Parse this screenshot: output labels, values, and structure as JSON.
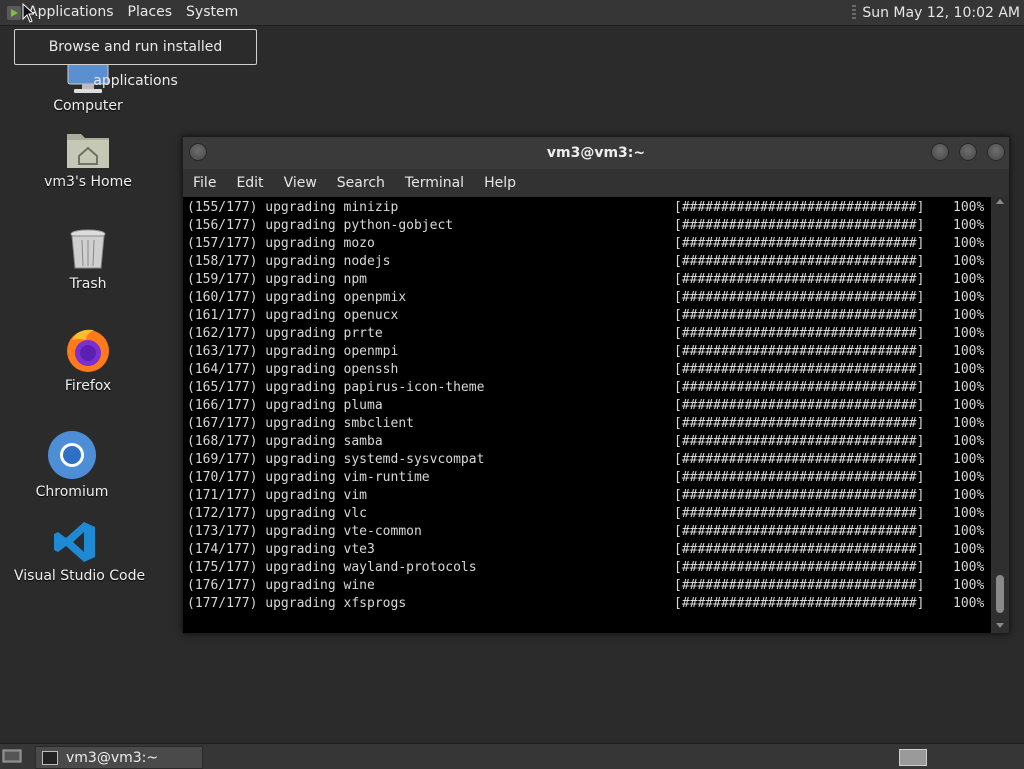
{
  "top_panel": {
    "menus": [
      "Applications",
      "Places",
      "System"
    ],
    "clock": "Sun May 12, 10:02 AM"
  },
  "tooltip": "Browse and run installed applications",
  "desktop_icons": [
    {
      "label": "Computer",
      "icon": "computer-icon"
    },
    {
      "label": "vm3's Home",
      "icon": "home-folder-icon"
    },
    {
      "label": "Trash",
      "icon": "trash-icon"
    },
    {
      "label": "Firefox",
      "icon": "firefox-icon"
    },
    {
      "label": "Chromium",
      "icon": "chromium-icon"
    },
    {
      "label": "Visual Studio Code",
      "icon": "vscode-icon"
    }
  ],
  "terminal": {
    "title": "vm3@vm3:~",
    "menu": [
      "File",
      "Edit",
      "View",
      "Search",
      "Terminal",
      "Help"
    ],
    "lines": [
      {
        "counter": "(155/177)",
        "action": "upgrading",
        "package": "minizip",
        "bar": "[##############################]",
        "pct": "100%"
      },
      {
        "counter": "(156/177)",
        "action": "upgrading",
        "package": "python-gobject",
        "bar": "[##############################]",
        "pct": "100%"
      },
      {
        "counter": "(157/177)",
        "action": "upgrading",
        "package": "mozo",
        "bar": "[##############################]",
        "pct": "100%"
      },
      {
        "counter": "(158/177)",
        "action": "upgrading",
        "package": "nodejs",
        "bar": "[##############################]",
        "pct": "100%"
      },
      {
        "counter": "(159/177)",
        "action": "upgrading",
        "package": "npm",
        "bar": "[##############################]",
        "pct": "100%"
      },
      {
        "counter": "(160/177)",
        "action": "upgrading",
        "package": "openpmix",
        "bar": "[##############################]",
        "pct": "100%"
      },
      {
        "counter": "(161/177)",
        "action": "upgrading",
        "package": "openucx",
        "bar": "[##############################]",
        "pct": "100%"
      },
      {
        "counter": "(162/177)",
        "action": "upgrading",
        "package": "prrte",
        "bar": "[##############################]",
        "pct": "100%"
      },
      {
        "counter": "(163/177)",
        "action": "upgrading",
        "package": "openmpi",
        "bar": "[##############################]",
        "pct": "100%"
      },
      {
        "counter": "(164/177)",
        "action": "upgrading",
        "package": "openssh",
        "bar": "[##############################]",
        "pct": "100%"
      },
      {
        "counter": "(165/177)",
        "action": "upgrading",
        "package": "papirus-icon-theme",
        "bar": "[##############################]",
        "pct": "100%"
      },
      {
        "counter": "(166/177)",
        "action": "upgrading",
        "package": "pluma",
        "bar": "[##############################]",
        "pct": "100%"
      },
      {
        "counter": "(167/177)",
        "action": "upgrading",
        "package": "smbclient",
        "bar": "[##############################]",
        "pct": "100%"
      },
      {
        "counter": "(168/177)",
        "action": "upgrading",
        "package": "samba",
        "bar": "[##############################]",
        "pct": "100%"
      },
      {
        "counter": "(169/177)",
        "action": "upgrading",
        "package": "systemd-sysvcompat",
        "bar": "[##############################]",
        "pct": "100%"
      },
      {
        "counter": "(170/177)",
        "action": "upgrading",
        "package": "vim-runtime",
        "bar": "[##############################]",
        "pct": "100%"
      },
      {
        "counter": "(171/177)",
        "action": "upgrading",
        "package": "vim",
        "bar": "[##############################]",
        "pct": "100%"
      },
      {
        "counter": "(172/177)",
        "action": "upgrading",
        "package": "vlc",
        "bar": "[##############################]",
        "pct": "100%"
      },
      {
        "counter": "(173/177)",
        "action": "upgrading",
        "package": "vte-common",
        "bar": "[##############################]",
        "pct": "100%"
      },
      {
        "counter": "(174/177)",
        "action": "upgrading",
        "package": "vte3",
        "bar": "[##############################]",
        "pct": "100%"
      },
      {
        "counter": "(175/177)",
        "action": "upgrading",
        "package": "wayland-protocols",
        "bar": "[##############################]",
        "pct": "100%"
      },
      {
        "counter": "(176/177)",
        "action": "upgrading",
        "package": "wine",
        "bar": "[##############################]",
        "pct": "100%"
      },
      {
        "counter": "(177/177)",
        "action": "upgrading",
        "package": "xfsprogs",
        "bar": "[##############################]",
        "pct": "100%"
      }
    ]
  },
  "taskbar": {
    "task_label": "vm3@vm3:~"
  },
  "colors": {
    "desktop_bg": "#2b2b2b",
    "panel_bg": "#363636",
    "terminal_bg": "#000000",
    "terminal_fg": "#d8d8d8"
  }
}
